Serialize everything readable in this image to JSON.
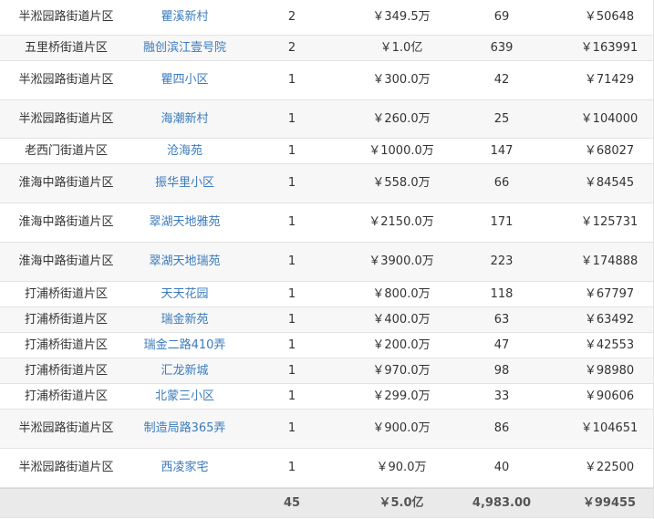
{
  "rows": [
    {
      "area": "半淞园路街道片区",
      "name": "瞿溪新村",
      "count": "2",
      "price": "￥349.5万",
      "size": "69",
      "unit": "￥50648"
    },
    {
      "area": "五里桥街道片区",
      "name": "融创滨江壹号院",
      "count": "2",
      "price": "￥1.0亿",
      "size": "639",
      "unit": "￥163991"
    },
    {
      "area": "半淞园路街道片区",
      "name": "瞿四小区",
      "count": "1",
      "price": "￥300.0万",
      "size": "42",
      "unit": "￥71429"
    },
    {
      "area": "半淞园路街道片区",
      "name": "海潮新村",
      "count": "1",
      "price": "￥260.0万",
      "size": "25",
      "unit": "￥104000"
    },
    {
      "area": "老西门街道片区",
      "name": "沧海苑",
      "count": "1",
      "price": "￥1000.0万",
      "size": "147",
      "unit": "￥68027"
    },
    {
      "area": "淮海中路街道片区",
      "name": "振华里小区",
      "count": "1",
      "price": "￥558.0万",
      "size": "66",
      "unit": "￥84545"
    },
    {
      "area": "淮海中路街道片区",
      "name": "翠湖天地雅苑",
      "count": "1",
      "price": "￥2150.0万",
      "size": "171",
      "unit": "￥125731"
    },
    {
      "area": "淮海中路街道片区",
      "name": "翠湖天地瑞苑",
      "count": "1",
      "price": "￥3900.0万",
      "size": "223",
      "unit": "￥174888"
    },
    {
      "area": "打浦桥街道片区",
      "name": "天天花园",
      "count": "1",
      "price": "￥800.0万",
      "size": "118",
      "unit": "￥67797"
    },
    {
      "area": "打浦桥街道片区",
      "name": "瑞金新苑",
      "count": "1",
      "price": "￥400.0万",
      "size": "63",
      "unit": "￥63492"
    },
    {
      "area": "打浦桥街道片区",
      "name": "瑞金二路410弄",
      "count": "1",
      "price": "￥200.0万",
      "size": "47",
      "unit": "￥42553"
    },
    {
      "area": "打浦桥街道片区",
      "name": "汇龙新城",
      "count": "1",
      "price": "￥970.0万",
      "size": "98",
      "unit": "￥98980"
    },
    {
      "area": "打浦桥街道片区",
      "name": "北蒙三小区",
      "count": "1",
      "price": "￥299.0万",
      "size": "33",
      "unit": "￥90606"
    },
    {
      "area": "半淞园路街道片区",
      "name": "制造局路365弄",
      "count": "1",
      "price": "￥900.0万",
      "size": "86",
      "unit": "￥104651"
    },
    {
      "area": "半淞园路街道片区",
      "name": "西凌家宅",
      "count": "1",
      "price": "￥90.0万",
      "size": "40",
      "unit": "￥22500"
    }
  ],
  "total": {
    "area": "",
    "name": "",
    "count": "45",
    "price": "￥5.0亿",
    "size": "4,983.00",
    "unit": "￥99455"
  }
}
